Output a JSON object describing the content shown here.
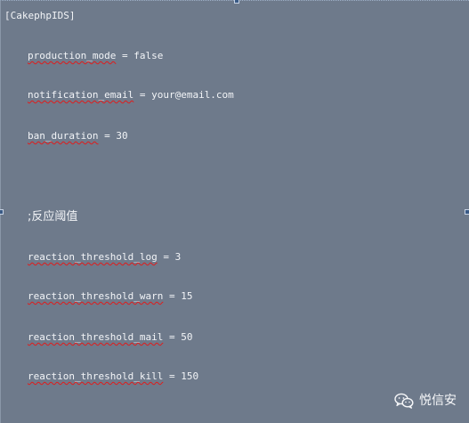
{
  "section_header": "[CakephpIDS]",
  "lines": [
    {
      "key": "production_mode",
      "rest": " = false"
    },
    {
      "key": "notification_email",
      "rest": " = your@email.com"
    },
    {
      "key": "ban_duration",
      "rest": " = 30"
    },
    {
      "key": "reaction_threshold_log",
      "rest": " = 3"
    },
    {
      "key": "reaction_threshold_warn",
      "rest": " = 15"
    },
    {
      "key": "reaction_threshold_mail",
      "rest": " = 50"
    },
    {
      "key": "reaction_threshold_kill",
      "rest": " = 150"
    }
  ],
  "comment": ";反应阈值",
  "watermark": {
    "label": "悦信安",
    "icon": "wechat-icon"
  },
  "colors": {
    "editor_background": "#6e7a8b",
    "text": "#f2f4f7",
    "spellcheck_underline": "#e01b1b"
  }
}
